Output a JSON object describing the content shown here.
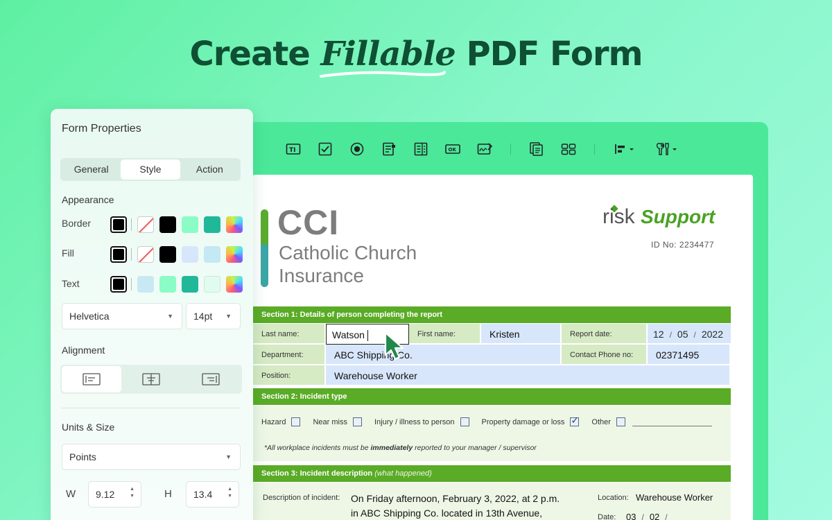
{
  "headline": {
    "prefix": "Create",
    "accent": "Fillable",
    "suffix": "PDF Form"
  },
  "toolbar": {
    "icons": [
      "text-field-icon",
      "checkbox-icon",
      "radio-button-icon",
      "combo-box-icon",
      "list-box-icon",
      "button-icon",
      "signature-icon",
      "duplicate-icon",
      "grid-icon",
      "align-dropdown-icon",
      "tools-dropdown-icon"
    ],
    "ok_label": "OK"
  },
  "document": {
    "logo_main": "CCI",
    "logo_sub_line1": "Catholic Church",
    "logo_sub_line2": "Insurance",
    "brand_risk": "risk",
    "brand_support": "Support",
    "id_no": "ID No: 2234477",
    "section1": {
      "title": "Section 1: Details of person completing the report",
      "last_name_label": "Last name:",
      "last_name_value": "Watson",
      "first_name_label": "First name:",
      "first_name_value": "Kristen",
      "report_date_label": "Report date:",
      "report_date": {
        "day": "12",
        "month": "05",
        "year": "2022",
        "sep": "/"
      },
      "department_label": "Department:",
      "department_value": "ABC Shipping Co.",
      "phone_label": "Contact Phone no:",
      "phone_value": "02371495",
      "position_label": "Position:",
      "position_value": "Warehouse Worker"
    },
    "section2": {
      "title": "Section 2: Incident type",
      "options": [
        {
          "label": "Hazard",
          "checked": false
        },
        {
          "label": "Near miss",
          "checked": false
        },
        {
          "label": "Injury / illness to person",
          "checked": false
        },
        {
          "label": "Property damage or loss",
          "checked": true
        },
        {
          "label": "Other",
          "checked": false
        }
      ],
      "note_pre": "*All workplace incidents must be ",
      "note_bold": "immediately",
      "note_post": " reported to your manager / supervisor"
    },
    "section3": {
      "title": "Section 3: Incident description",
      "hint": "(what happened)",
      "desc_label": "Description of incident:",
      "desc_line1": "On Friday afternoon, February 3, 2022, at 2 p.m.",
      "desc_line2": "in ABC Shipping Co. located in 13th Avenue,",
      "location_label": "Location:",
      "location_value": "Warehouse Worker",
      "date_label": "Date:",
      "date_d": "03",
      "date_m": "02",
      "date_sep": "/"
    }
  },
  "props": {
    "title": "Form Properties",
    "tabs": [
      "General",
      "Style",
      "Action"
    ],
    "active_tab": "Style",
    "appearance_title": "Appearance",
    "border_label": "Border",
    "fill_label": "Fill",
    "text_label": "Text",
    "colors": {
      "border": [
        "none",
        "#000000",
        "#8bfcc6",
        "#20b898",
        "gradient"
      ],
      "fill": [
        "none",
        "#000000",
        "#d8e6fb",
        "#c4e8f4",
        "gradient"
      ],
      "text": [
        "#c8e9f4",
        "#8bfcc6",
        "#20b898",
        "#e0fbef",
        "gradient"
      ]
    },
    "font": "Helvetica",
    "font_size": "14pt",
    "alignment_title": "Alignment",
    "alignment_selected": "left",
    "units_title": "Units & Size",
    "units": "Points",
    "w_label": "W",
    "w_value": "9.12",
    "h_label": "H",
    "h_value": "13.4"
  }
}
